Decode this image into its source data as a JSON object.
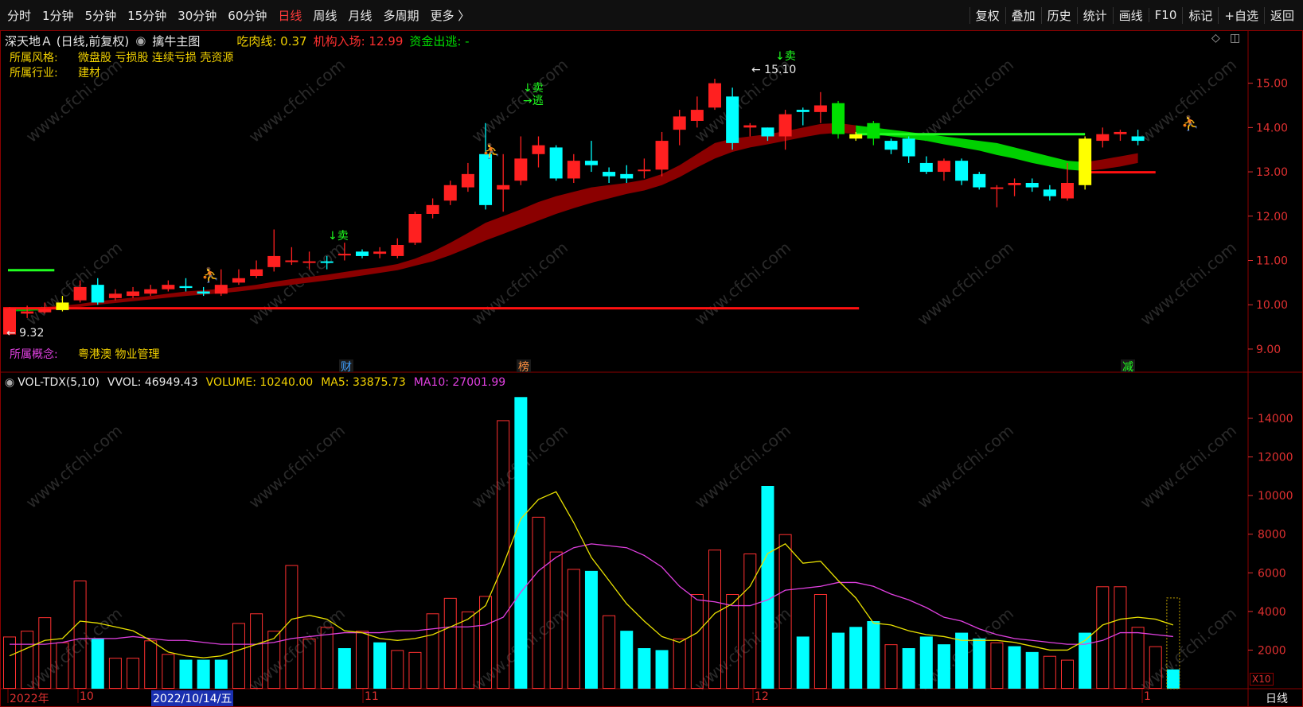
{
  "toolbar": {
    "periods": [
      "分时",
      "1分钟",
      "5分钟",
      "15分钟",
      "30分钟",
      "60分钟",
      "日线",
      "周线",
      "月线",
      "多周期",
      "更多 〉"
    ],
    "active_index": 6,
    "right": [
      "复权",
      "叠加",
      "历史",
      "统计",
      "画线",
      "F10",
      "标记",
      "+自选",
      "返回"
    ]
  },
  "info": {
    "stock": "深天地Ａ (日线,前复权)",
    "indicator": "擒牛主图",
    "eat_meat": "吃肉线: 0.37",
    "inst_entry": "机构入场: 12.99",
    "fund_out": "资金出逃: -"
  },
  "tags": {
    "style_key": "所属风格:",
    "style_val": "微盘股 亏损股 连续亏损 壳资源",
    "industry_key": "所属行业:",
    "industry_val": "建材",
    "concept_key": "所属概念:",
    "concept_val": "粤港澳 物业管理"
  },
  "markers": {
    "sell1": "↓卖",
    "sell2": "↓卖",
    "escape": "→逃",
    "sell3": "↓卖",
    "high_label": "← 15.10",
    "low_label": "← 9.32",
    "cai": "财",
    "bang": "榜",
    "jian": "减"
  },
  "vol_header": {
    "name": "VOL-TDX(5,10)",
    "vvol": "VVOL: 46949.43",
    "volume": "VOLUME: 10240.00",
    "ma5": "MA5: 33875.73",
    "ma10": "MA10: 27001.99"
  },
  "date_axis": {
    "labels": [
      "2022年",
      "10",
      "2022/10/14/五",
      "11",
      "12",
      "1"
    ],
    "period_tag": "日线",
    "scale_tag": "X10"
  },
  "chart_data": [
    {
      "type": "candlestick",
      "yticks": [
        9.0,
        10.0,
        11.0,
        12.0,
        13.0,
        14.0,
        15.0
      ],
      "ylim": [
        8.55,
        15.55
      ],
      "ohlc": [
        [
          9.92,
          9.33,
          9.32,
          9.95,
          "red"
        ],
        [
          9.8,
          9.85,
          9.7,
          9.98,
          "red"
        ],
        [
          9.83,
          9.9,
          9.8,
          10.05,
          "red"
        ],
        [
          9.88,
          10.05,
          9.85,
          10.2,
          "yellow"
        ],
        [
          10.1,
          10.4,
          10.05,
          10.55,
          "red"
        ],
        [
          10.45,
          10.05,
          10.0,
          10.6,
          "cyan"
        ],
        [
          10.15,
          10.25,
          10.1,
          10.35,
          "red"
        ],
        [
          10.2,
          10.3,
          10.15,
          10.4,
          "red"
        ],
        [
          10.25,
          10.35,
          10.2,
          10.45,
          "red"
        ],
        [
          10.35,
          10.45,
          10.3,
          10.55,
          "red"
        ],
        [
          10.42,
          10.38,
          10.3,
          10.6,
          "cyan"
        ],
        [
          10.3,
          10.25,
          10.2,
          10.4,
          "cyan"
        ],
        [
          10.25,
          10.45,
          10.2,
          10.8,
          "red"
        ],
        [
          10.5,
          10.6,
          10.45,
          10.8,
          "red"
        ],
        [
          10.65,
          10.8,
          10.6,
          11.0,
          "red"
        ],
        [
          10.85,
          11.1,
          10.75,
          11.7,
          "red"
        ],
        [
          11.0,
          11.0,
          10.9,
          11.3,
          "red"
        ],
        [
          10.98,
          10.98,
          10.8,
          11.2,
          "red"
        ],
        [
          10.98,
          10.98,
          10.8,
          11.1,
          "cyan"
        ],
        [
          11.15,
          11.15,
          11.0,
          11.4,
          "red"
        ],
        [
          11.2,
          11.1,
          11.05,
          11.25,
          "cyan"
        ],
        [
          11.15,
          11.2,
          11.05,
          11.3,
          "red"
        ],
        [
          11.1,
          11.35,
          11.05,
          11.5,
          "red"
        ],
        [
          11.4,
          12.05,
          11.35,
          12.1,
          "red"
        ],
        [
          12.05,
          12.25,
          11.95,
          12.4,
          "red"
        ],
        [
          12.35,
          12.7,
          12.25,
          12.8,
          "red"
        ],
        [
          12.65,
          12.95,
          12.55,
          13.2,
          "red"
        ],
        [
          13.4,
          12.25,
          12.15,
          14.1,
          "cyan"
        ],
        [
          12.7,
          12.6,
          12.1,
          13.4,
          "red"
        ],
        [
          12.8,
          13.3,
          12.7,
          13.8,
          "red"
        ],
        [
          13.4,
          13.6,
          13.1,
          13.8,
          "red"
        ],
        [
          13.55,
          12.85,
          12.8,
          13.6,
          "cyan"
        ],
        [
          12.85,
          13.25,
          12.75,
          13.4,
          "red"
        ],
        [
          13.25,
          13.15,
          13.0,
          13.7,
          "cyan"
        ],
        [
          13.0,
          12.9,
          12.75,
          13.1,
          "cyan"
        ],
        [
          12.95,
          12.85,
          12.75,
          13.15,
          "cyan"
        ],
        [
          13.05,
          13.05,
          12.85,
          13.3,
          "red"
        ],
        [
          13.05,
          13.7,
          12.9,
          13.9,
          "red"
        ],
        [
          13.95,
          14.25,
          13.6,
          14.4,
          "red"
        ],
        [
          14.15,
          14.4,
          14.0,
          14.7,
          "red"
        ],
        [
          14.45,
          15.0,
          14.4,
          15.1,
          "red"
        ],
        [
          14.7,
          13.65,
          13.5,
          14.9,
          "cyan"
        ],
        [
          14.0,
          14.05,
          13.8,
          14.1,
          "red"
        ],
        [
          14.0,
          13.8,
          13.7,
          14.0,
          "cyan"
        ],
        [
          13.8,
          14.3,
          13.5,
          14.4,
          "red"
        ],
        [
          14.35,
          14.4,
          14.05,
          14.45,
          "cyan"
        ],
        [
          14.35,
          14.5,
          14.1,
          14.8,
          "red"
        ],
        [
          14.55,
          13.85,
          13.75,
          14.6,
          "green"
        ],
        [
          13.85,
          13.75,
          13.7,
          13.9,
          "yellow"
        ],
        [
          14.1,
          13.75,
          13.6,
          14.15,
          "green"
        ],
        [
          13.7,
          13.5,
          13.4,
          13.75,
          "cyan"
        ],
        [
          13.75,
          13.35,
          13.2,
          13.8,
          "cyan"
        ],
        [
          13.2,
          13.0,
          12.95,
          13.35,
          "cyan"
        ],
        [
          13.0,
          13.25,
          12.8,
          13.3,
          "red"
        ],
        [
          13.25,
          12.8,
          12.7,
          13.3,
          "cyan"
        ],
        [
          12.95,
          12.65,
          12.6,
          13.0,
          "cyan"
        ],
        [
          12.65,
          12.65,
          12.2,
          12.7,
          "red"
        ],
        [
          12.7,
          12.75,
          12.45,
          12.85,
          "red"
        ],
        [
          12.65,
          12.75,
          12.55,
          12.85,
          "cyan"
        ],
        [
          12.6,
          12.45,
          12.35,
          12.7,
          "cyan"
        ],
        [
          12.4,
          12.75,
          12.35,
          13.2,
          "red"
        ],
        [
          12.7,
          13.75,
          12.6,
          13.8,
          "yellow"
        ],
        [
          13.7,
          13.85,
          13.55,
          14.0,
          "red"
        ],
        [
          13.85,
          13.9,
          13.7,
          13.95,
          "red"
        ],
        [
          13.8,
          13.7,
          13.6,
          13.95,
          "cyan"
        ]
      ],
      "trend_band_upper": [
        9.93,
        9.93,
        9.95,
        9.98,
        10.02,
        10.08,
        10.12,
        10.16,
        10.2,
        10.25,
        10.3,
        10.33,
        10.36,
        10.4,
        10.45,
        10.52,
        10.58,
        10.63,
        10.68,
        10.74,
        10.8,
        10.85,
        10.92,
        11.04,
        11.2,
        11.4,
        11.62,
        11.85,
        12.0,
        12.15,
        12.32,
        12.45,
        12.55,
        12.65,
        12.7,
        12.75,
        12.82,
        12.95,
        13.15,
        13.4,
        13.65,
        13.75,
        13.8,
        13.85,
        13.92,
        14.0,
        14.08,
        14.1,
        14.05,
        14.0,
        13.95,
        13.9,
        13.85,
        13.8,
        13.75,
        13.7,
        13.65,
        13.55,
        13.45,
        13.35,
        13.25,
        13.22,
        13.28,
        13.35,
        13.42
      ],
      "trend_band_lower": [
        9.85,
        9.86,
        9.88,
        9.9,
        9.95,
        10.0,
        10.04,
        10.08,
        10.12,
        10.16,
        10.2,
        10.23,
        10.26,
        10.3,
        10.35,
        10.4,
        10.45,
        10.5,
        10.55,
        10.6,
        10.66,
        10.72,
        10.78,
        10.88,
        10.98,
        11.12,
        11.28,
        11.45,
        11.6,
        11.75,
        11.9,
        12.05,
        12.18,
        12.3,
        12.4,
        12.5,
        12.58,
        12.7,
        12.88,
        13.1,
        13.3,
        13.45,
        13.55,
        13.62,
        13.7,
        13.78,
        13.85,
        13.88,
        13.86,
        13.85,
        13.8,
        13.75,
        13.7,
        13.62,
        13.55,
        13.48,
        13.38,
        13.3,
        13.2,
        13.12,
        13.05,
        13.02,
        13.06,
        13.12,
        13.2
      ],
      "lines": {
        "red_support": {
          "value": 9.92,
          "from": 0,
          "to": 48
        },
        "green_top": {
          "value": 13.85,
          "from": 48,
          "to": 61
        },
        "red_right": {
          "value": 12.99,
          "from": 61,
          "to": 65
        },
        "green_left": {
          "value": 10.78,
          "from": 0,
          "to": 2
        }
      }
    },
    {
      "type": "bar",
      "yticks": [
        2000,
        4000,
        6000,
        8000,
        10000,
        12000,
        14000
      ],
      "ylim": [
        0,
        15400
      ],
      "volume": [
        2700,
        3000,
        3700,
        2400,
        5600,
        2600,
        1600,
        1600,
        2500,
        1800,
        1500,
        1500,
        1500,
        3400,
        3900,
        3000,
        6400,
        2600,
        3200,
        2100,
        3000,
        2400,
        2000,
        1900,
        3900,
        4700,
        4000,
        4800,
        13900,
        15100,
        8900,
        7100,
        6200,
        6100,
        3800,
        3000,
        2100,
        2000,
        2600,
        4900,
        7200,
        4900,
        7000,
        10500,
        8000,
        2700,
        4900,
        2900,
        3200,
        3500,
        2300,
        2100,
        2700,
        2300,
        2900,
        2600,
        2400,
        2200,
        1900,
        1700,
        1500,
        2900,
        5300,
        5300,
        3200,
        2200,
        1000
      ],
      "colors": [
        "r",
        "r",
        "r",
        "r",
        "r",
        "c",
        "r",
        "r",
        "r",
        "r",
        "c",
        "c",
        "c",
        "r",
        "r",
        "r",
        "r",
        "r",
        "r",
        "c",
        "r",
        "c",
        "r",
        "r",
        "r",
        "r",
        "r",
        "r",
        "r",
        "c",
        "r",
        "r",
        "r",
        "c",
        "r",
        "c",
        "c",
        "c",
        "r",
        "r",
        "r",
        "r",
        "r",
        "c",
        "r",
        "c",
        "r",
        "c",
        "c",
        "c",
        "r",
        "c",
        "c",
        "c",
        "c",
        "c",
        "r",
        "c",
        "c",
        "r",
        "r",
        "c",
        "r",
        "r",
        "r",
        "r",
        "c"
      ],
      "ma5": [
        1700,
        2100,
        2500,
        2600,
        3500,
        3400,
        3200,
        3000,
        2500,
        1900,
        1700,
        1600,
        1700,
        2000,
        2300,
        2600,
        3600,
        3800,
        3600,
        3000,
        2900,
        2600,
        2500,
        2600,
        2800,
        3200,
        3600,
        4300,
        6400,
        8800,
        9800,
        10200,
        8600,
        6800,
        5600,
        4400,
        3500,
        2700,
        2400,
        2900,
        3900,
        4400,
        5300,
        7000,
        7500,
        6500,
        6600,
        5600,
        4700,
        3400,
        3300,
        3000,
        2800,
        2700,
        2500,
        2500,
        2500,
        2400,
        2200,
        2000,
        2000,
        2500,
        3300,
        3600,
        3700,
        3600,
        3300
      ],
      "ma10": [
        2300,
        2300,
        2300,
        2400,
        2600,
        2600,
        2600,
        2700,
        2600,
        2500,
        2500,
        2400,
        2300,
        2300,
        2300,
        2400,
        2600,
        2700,
        2800,
        2900,
        2900,
        2900,
        3000,
        3000,
        3100,
        3200,
        3200,
        3300,
        3700,
        5000,
        6100,
        6800,
        7300,
        7500,
        7400,
        7300,
        6900,
        6300,
        5300,
        4600,
        4500,
        4300,
        4300,
        4600,
        5100,
        5200,
        5300,
        5500,
        5500,
        5300,
        4900,
        4600,
        4200,
        3700,
        3500,
        3100,
        2800,
        2600,
        2500,
        2400,
        2300,
        2300,
        2500,
        2900,
        2900,
        2800,
        2700
      ]
    }
  ]
}
